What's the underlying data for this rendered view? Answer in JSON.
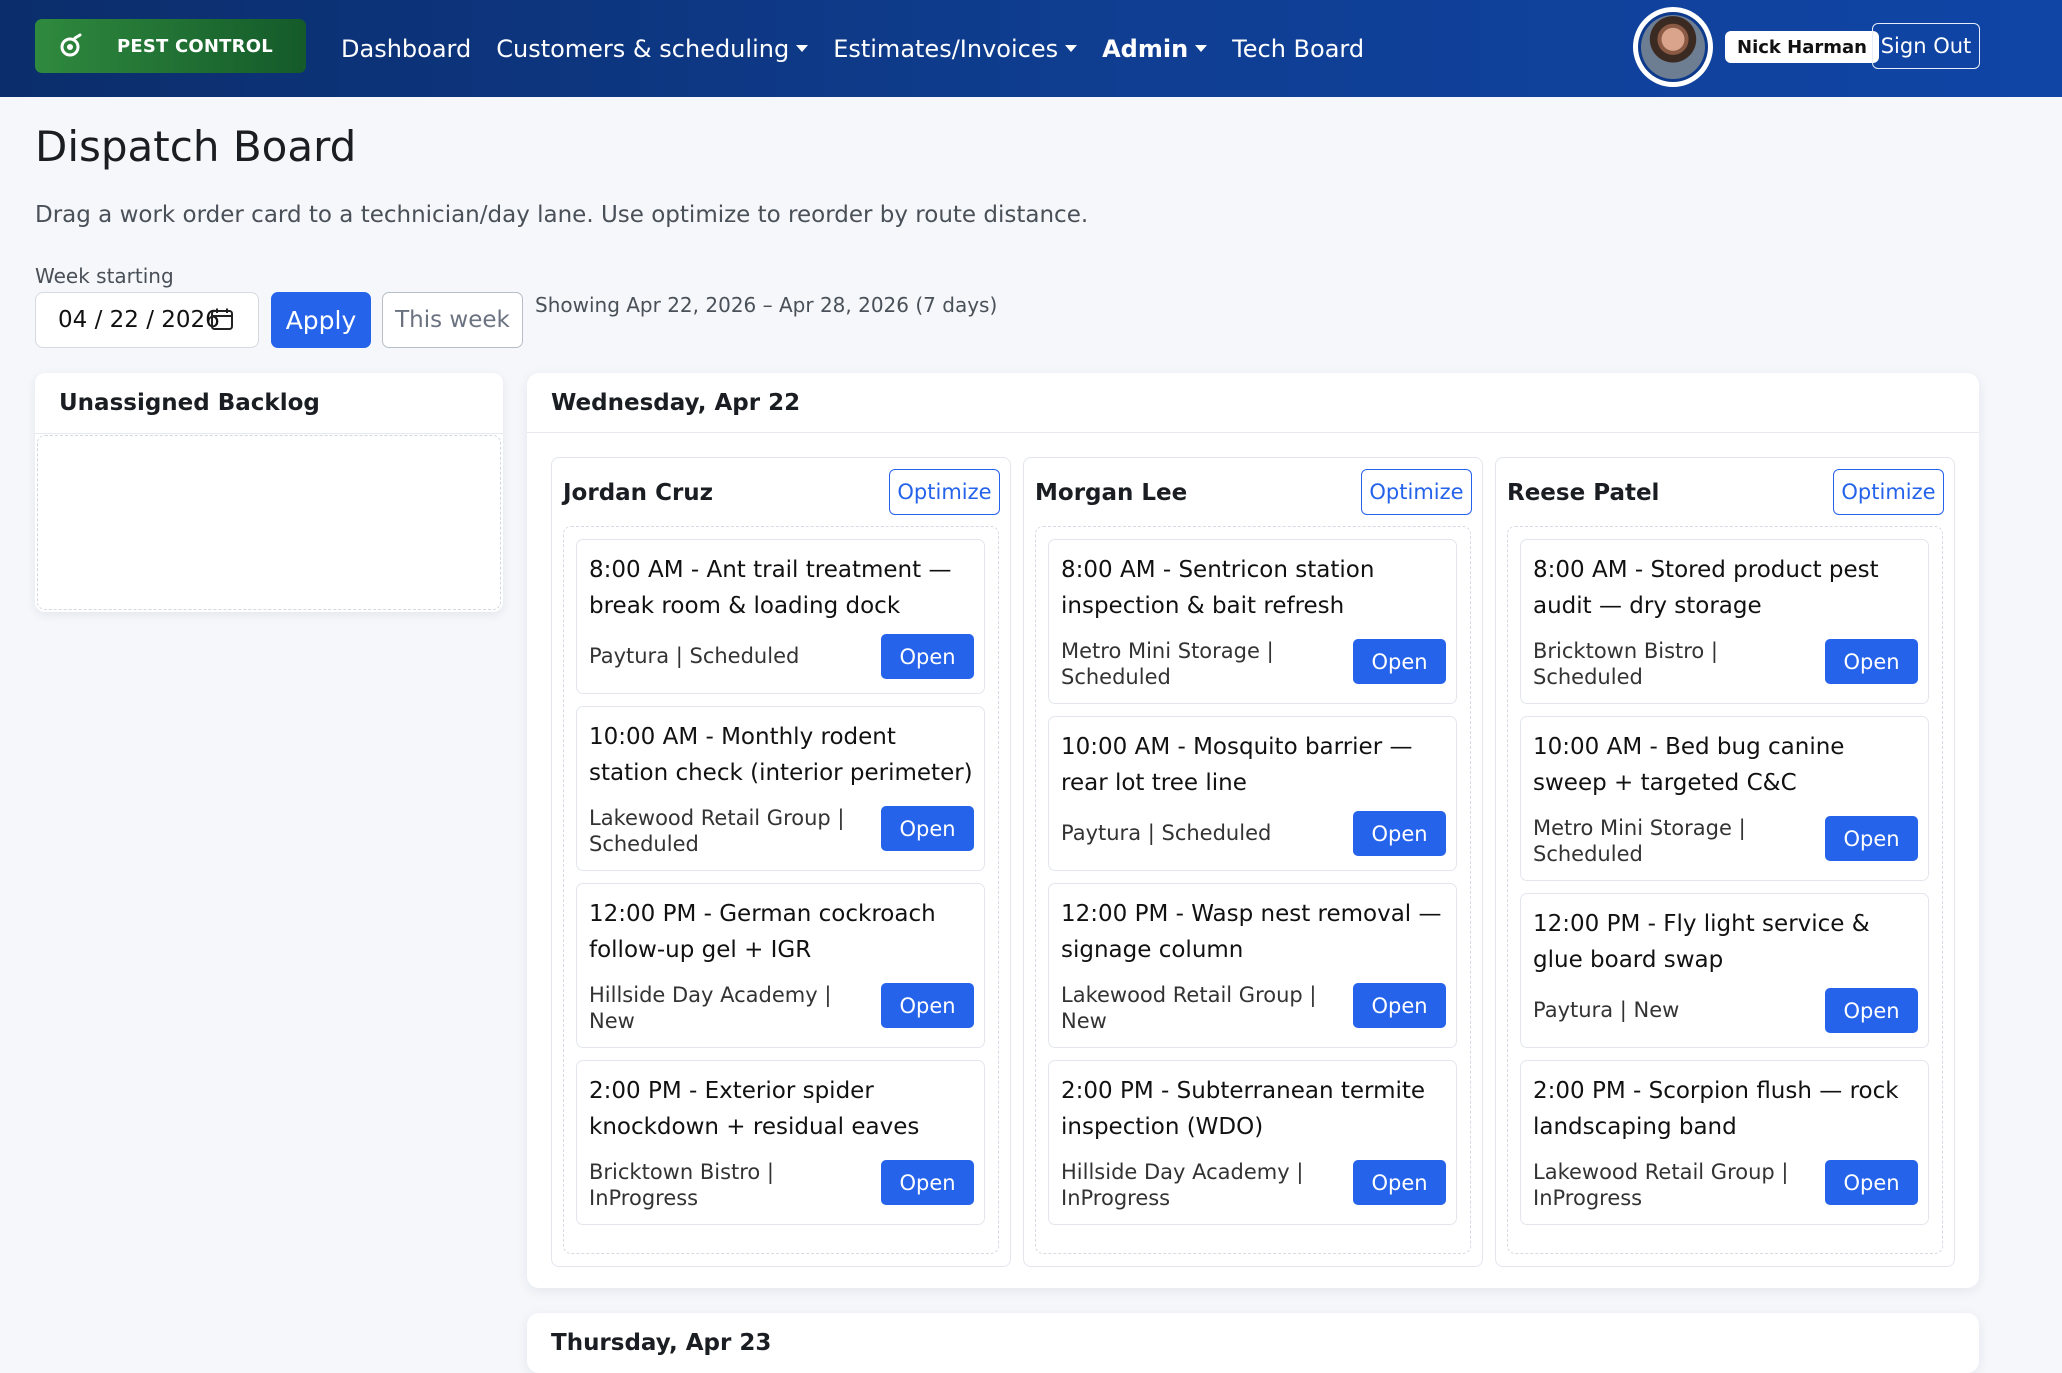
{
  "nav": {
    "brand": "PEST CONTROL",
    "links": [
      {
        "label": "Dashboard"
      },
      {
        "label": "Customers & scheduling"
      },
      {
        "label": "Estimates/Invoices"
      },
      {
        "label": "Admin"
      },
      {
        "label": "Tech Board"
      }
    ],
    "user_name": "Nick Harman",
    "sign_out": "Sign Out"
  },
  "page": {
    "title": "Dispatch Board",
    "description": "Drag a work order card to a technician/day lane. Use optimize to reorder by route distance.",
    "week_label": "Week starting",
    "week_value": "04 / 22 / 2026",
    "apply_label": "Apply",
    "this_week_label": "This week",
    "range_text": "Showing Apr 22, 2026 – Apr 28, 2026 (7 days)"
  },
  "backlog": {
    "title": "Unassigned Backlog"
  },
  "day": {
    "title": "Wednesday, Apr 22",
    "lanes": [
      {
        "tech": "Jordan Cruz",
        "optimize": "Optimize",
        "cards": [
          {
            "title": "8:00 AM - Ant trail treatment — break room & loading dock",
            "meta": "Paytura | Scheduled",
            "open": "Open"
          },
          {
            "title": "10:00 AM - Monthly rodent station check (interior perimeter)",
            "meta": "Lakewood Retail Group | Scheduled",
            "open": "Open"
          },
          {
            "title": "12:00 PM - German cockroach follow-up gel + IGR",
            "meta": "Hillside Day Academy | New",
            "open": "Open"
          },
          {
            "title": "2:00 PM - Exterior spider knockdown + residual eaves",
            "meta": "Bricktown Bistro | InProgress",
            "open": "Open"
          }
        ]
      },
      {
        "tech": "Morgan Lee",
        "optimize": "Optimize",
        "cards": [
          {
            "title": "8:00 AM - Sentricon station inspection & bait refresh",
            "meta": "Metro Mini Storage | Scheduled",
            "open": "Open"
          },
          {
            "title": "10:00 AM - Mosquito barrier — rear lot tree line",
            "meta": "Paytura | Scheduled",
            "open": "Open"
          },
          {
            "title": "12:00 PM - Wasp nest removal — signage column",
            "meta": "Lakewood Retail Group | New",
            "open": "Open"
          },
          {
            "title": "2:00 PM - Subterranean termite inspection (WDO)",
            "meta": "Hillside Day Academy | InProgress",
            "open": "Open"
          }
        ]
      },
      {
        "tech": "Reese Patel",
        "optimize": "Optimize",
        "cards": [
          {
            "title": "8:00 AM - Stored product pest audit — dry storage",
            "meta": "Bricktown Bistro | Scheduled",
            "open": "Open"
          },
          {
            "title": "10:00 AM - Bed bug canine sweep + targeted C&C",
            "meta": "Metro Mini Storage | Scheduled",
            "open": "Open"
          },
          {
            "title": "12:00 PM - Fly light service & glue board swap",
            "meta": "Paytura | New",
            "open": "Open"
          },
          {
            "title": "2:00 PM - Scorpion flush — rock landscaping band",
            "meta": "Lakewood Retail Group | InProgress",
            "open": "Open"
          }
        ]
      }
    ]
  },
  "next_day": {
    "title": "Thursday, Apr 23"
  },
  "colors": {
    "primary": "#2563eb",
    "navbar": "#0f3e92",
    "brand_green": "#2f8a3e"
  }
}
